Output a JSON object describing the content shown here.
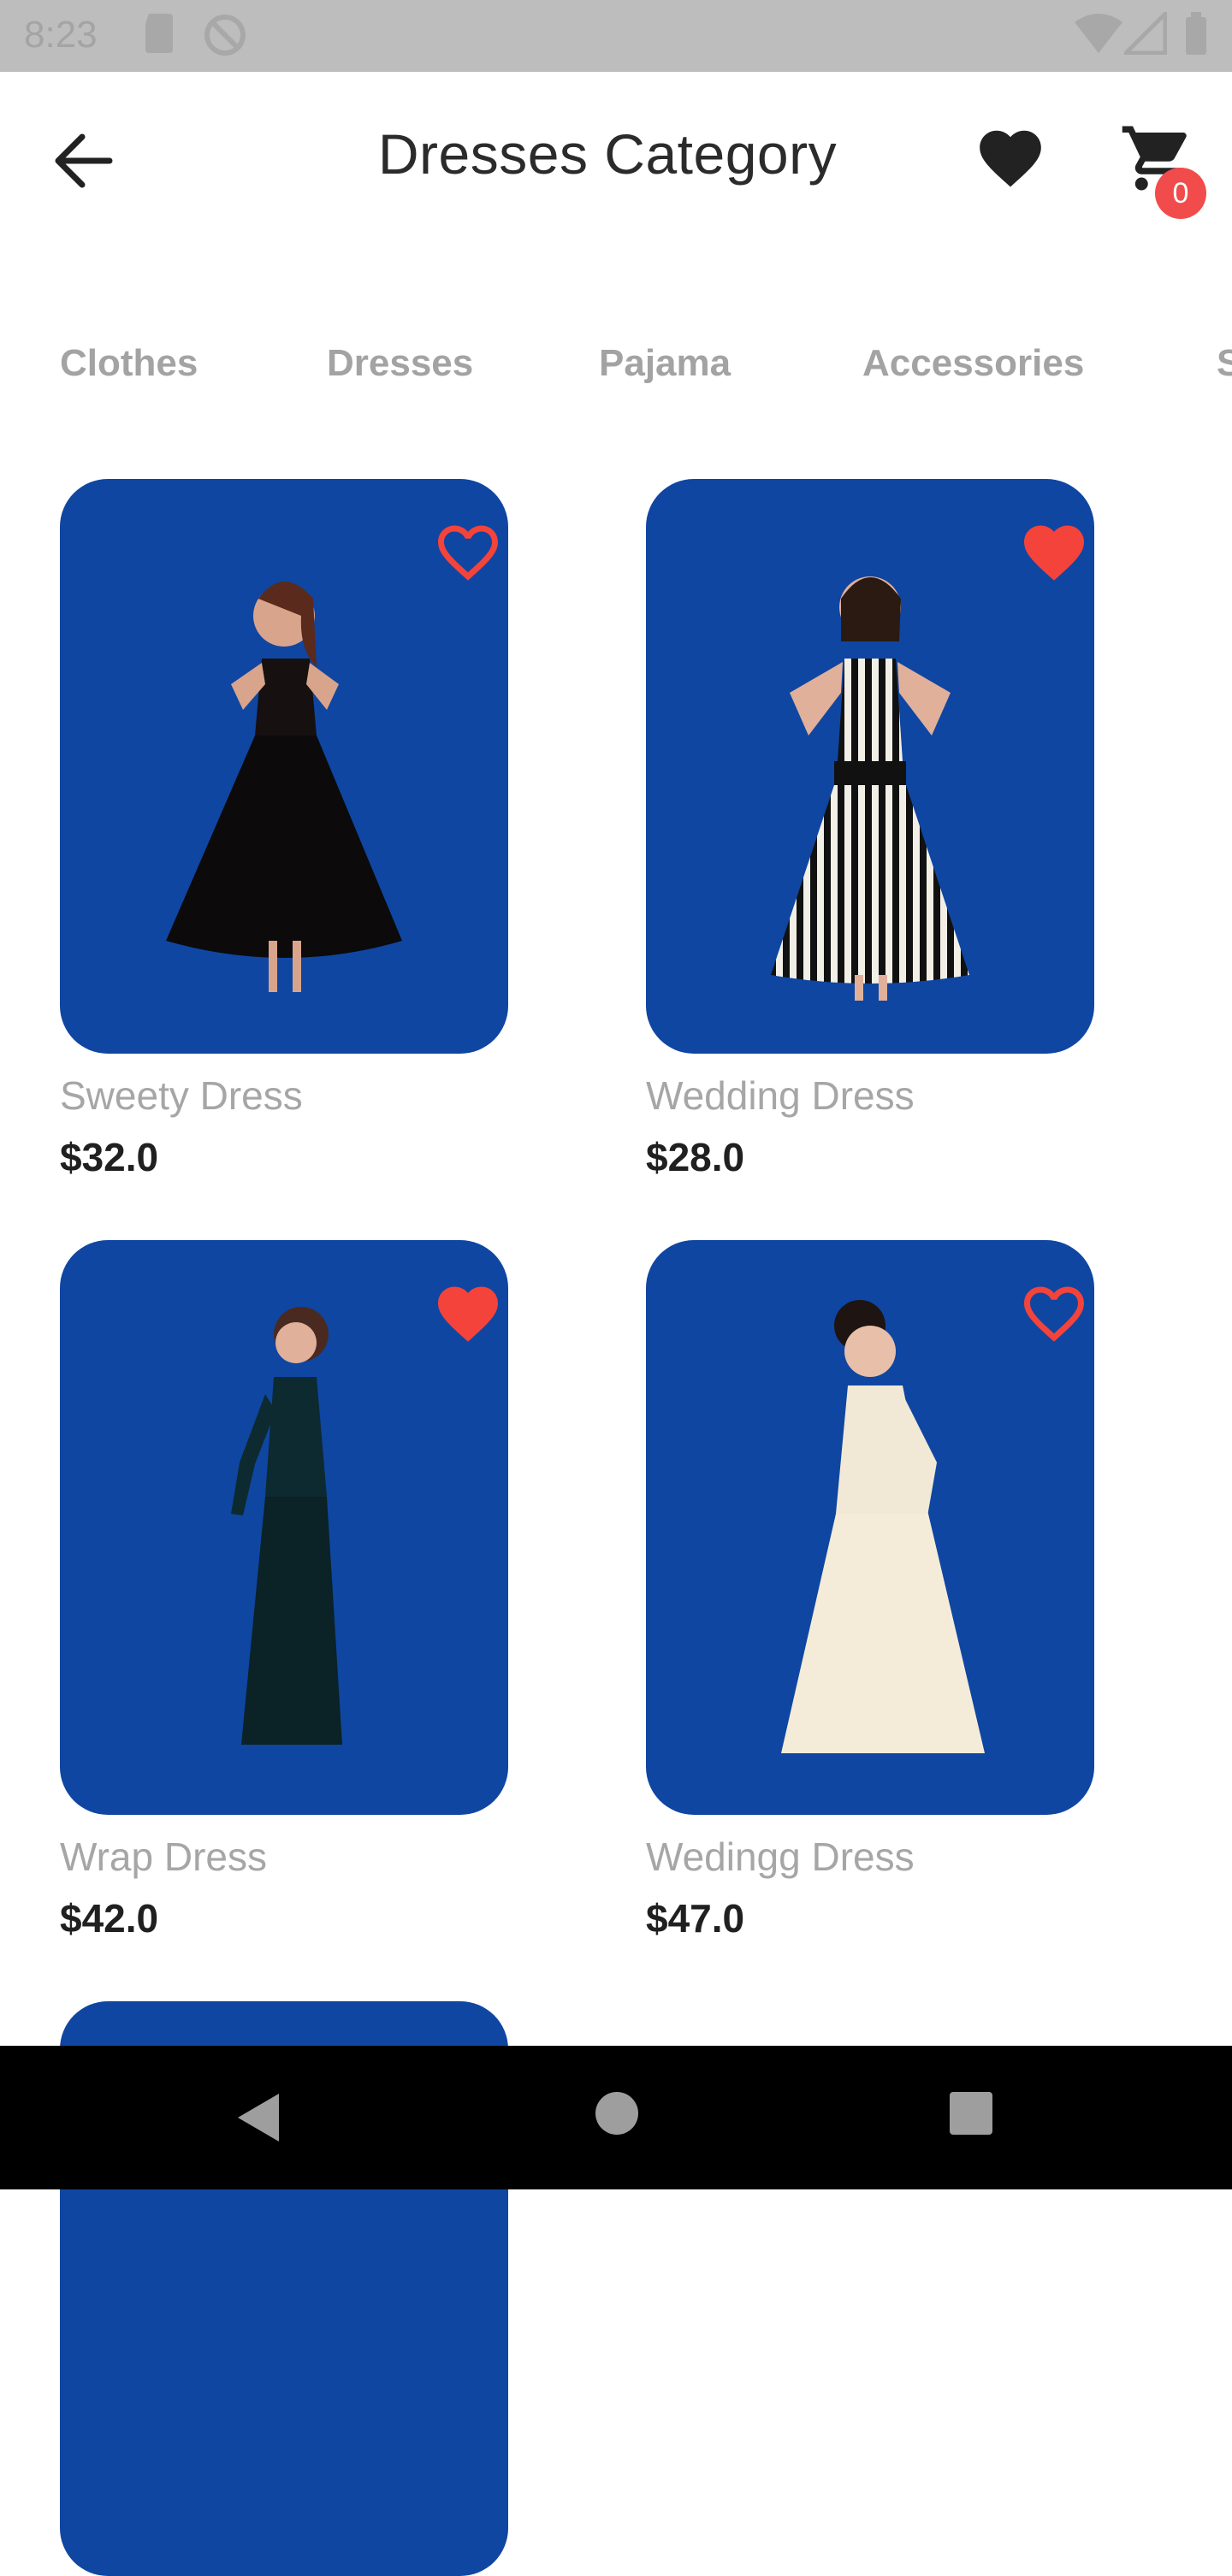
{
  "status_bar": {
    "time": "8:23"
  },
  "header": {
    "title": "Dresses Category",
    "cart_count": "0"
  },
  "tabs": [
    "Clothes",
    "Dresses",
    "Pajama",
    "Accessories",
    "S"
  ],
  "products": [
    {
      "name": "Sweety Dress",
      "price": "$32.0",
      "favorite": false
    },
    {
      "name": "Wedding Dress",
      "price": "$28.0",
      "favorite": true
    },
    {
      "name": "Wrap Dress",
      "price": "$42.0",
      "favorite": true
    },
    {
      "name": "Wedingg Dress",
      "price": "$47.0",
      "favorite": false
    }
  ],
  "colors": {
    "card_bg": "#0f46a2",
    "heart": "#f4433a",
    "badge": "#f24b4b"
  },
  "icons": [
    "arrow-back-icon",
    "heart-icon",
    "cart-icon",
    "nav-back-icon",
    "nav-home-icon",
    "nav-recents-icon"
  ]
}
